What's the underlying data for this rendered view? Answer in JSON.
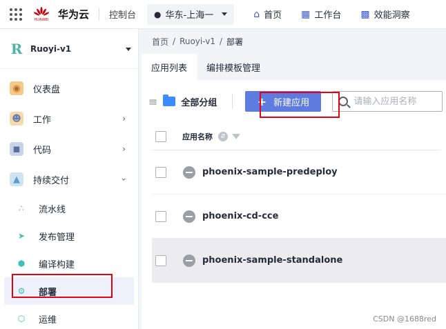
{
  "topbar": {
    "logo_text": "HUAWEI",
    "brand": "华为云",
    "console": "控制台",
    "region": "华东-上海一",
    "nav": [
      {
        "label": "首页"
      },
      {
        "label": "工作台"
      },
      {
        "label": "效能洞察"
      }
    ]
  },
  "sidebar": {
    "project": "Ruoyi-v1",
    "items": [
      {
        "label": "仪表盘"
      },
      {
        "label": "工作"
      },
      {
        "label": "代码"
      },
      {
        "label": "持续交付"
      }
    ],
    "sub_items": [
      {
        "label": "流水线"
      },
      {
        "label": "发布管理"
      },
      {
        "label": "编译构建"
      },
      {
        "label": "部署"
      },
      {
        "label": "运维"
      }
    ]
  },
  "breadcrumb": [
    "首页",
    "Ruoyi-v1",
    "部署"
  ],
  "tabs": [
    {
      "label": "应用列表",
      "active": true
    },
    {
      "label": "编排模板管理",
      "active": false
    }
  ],
  "toolbar": {
    "group_label": "全部分组",
    "new_button": "新建应用",
    "search_placeholder": "请输入应用名称"
  },
  "table": {
    "header": "应用名称",
    "rows": [
      {
        "name": "phoenix-sample-predeploy"
      },
      {
        "name": "phoenix-cd-cce"
      },
      {
        "name": "phoenix-sample-standalone"
      }
    ]
  },
  "watermark": "CSDN @1688red",
  "colors": {
    "accent": "#5e7ce0",
    "highlight_box": "#e60012",
    "huawei_red": "#c7000b"
  }
}
